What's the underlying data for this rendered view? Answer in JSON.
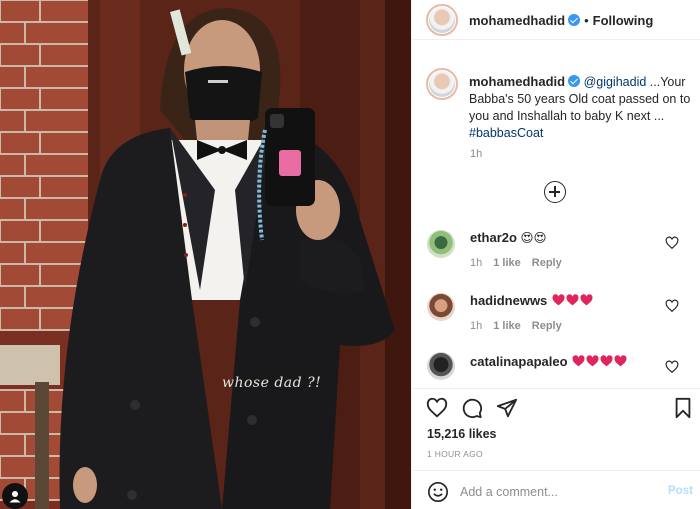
{
  "photo": {
    "overlay_text": "whose dad ?!",
    "phone_case_text": "pink"
  },
  "header": {
    "username": "mohamedhadid",
    "separator": "•",
    "follow_status": "Following"
  },
  "caption": {
    "username": "mohamedhadid",
    "mention": "@gigihadid",
    "text": " ...Your Babba's 50 years Old coat passed on to you and Inshallah to baby K next ... ",
    "hashtag": "#babbasCoat",
    "time": "1h"
  },
  "comments": [
    {
      "username": "ethar2o",
      "hearts": 0,
      "extra": "😍😍",
      "time": "1h",
      "likes": "1 like",
      "reply": "Reply"
    },
    {
      "username": "hadidnewws",
      "hearts": 3,
      "time": "1h",
      "likes": "1 like",
      "reply": "Reply"
    },
    {
      "username": "catalinapapaleo",
      "hearts": 4,
      "time": "",
      "likes": "",
      "reply": ""
    }
  ],
  "actions": {
    "likes": "15,216 likes",
    "posted": "1 HOUR AGO",
    "comment_placeholder": "Add a comment...",
    "post_label": "Post"
  },
  "colors": {
    "accent_blue": "#3897f0",
    "link_blue": "#00376b",
    "muted": "#8e8e8e",
    "heart_red": "#e0245e",
    "post_disabled": "#b2dffc"
  },
  "icons": [
    "verified-icon",
    "heart-icon",
    "comment-icon",
    "share-icon",
    "bookmark-icon",
    "smile-icon",
    "plus-circle-icon"
  ]
}
